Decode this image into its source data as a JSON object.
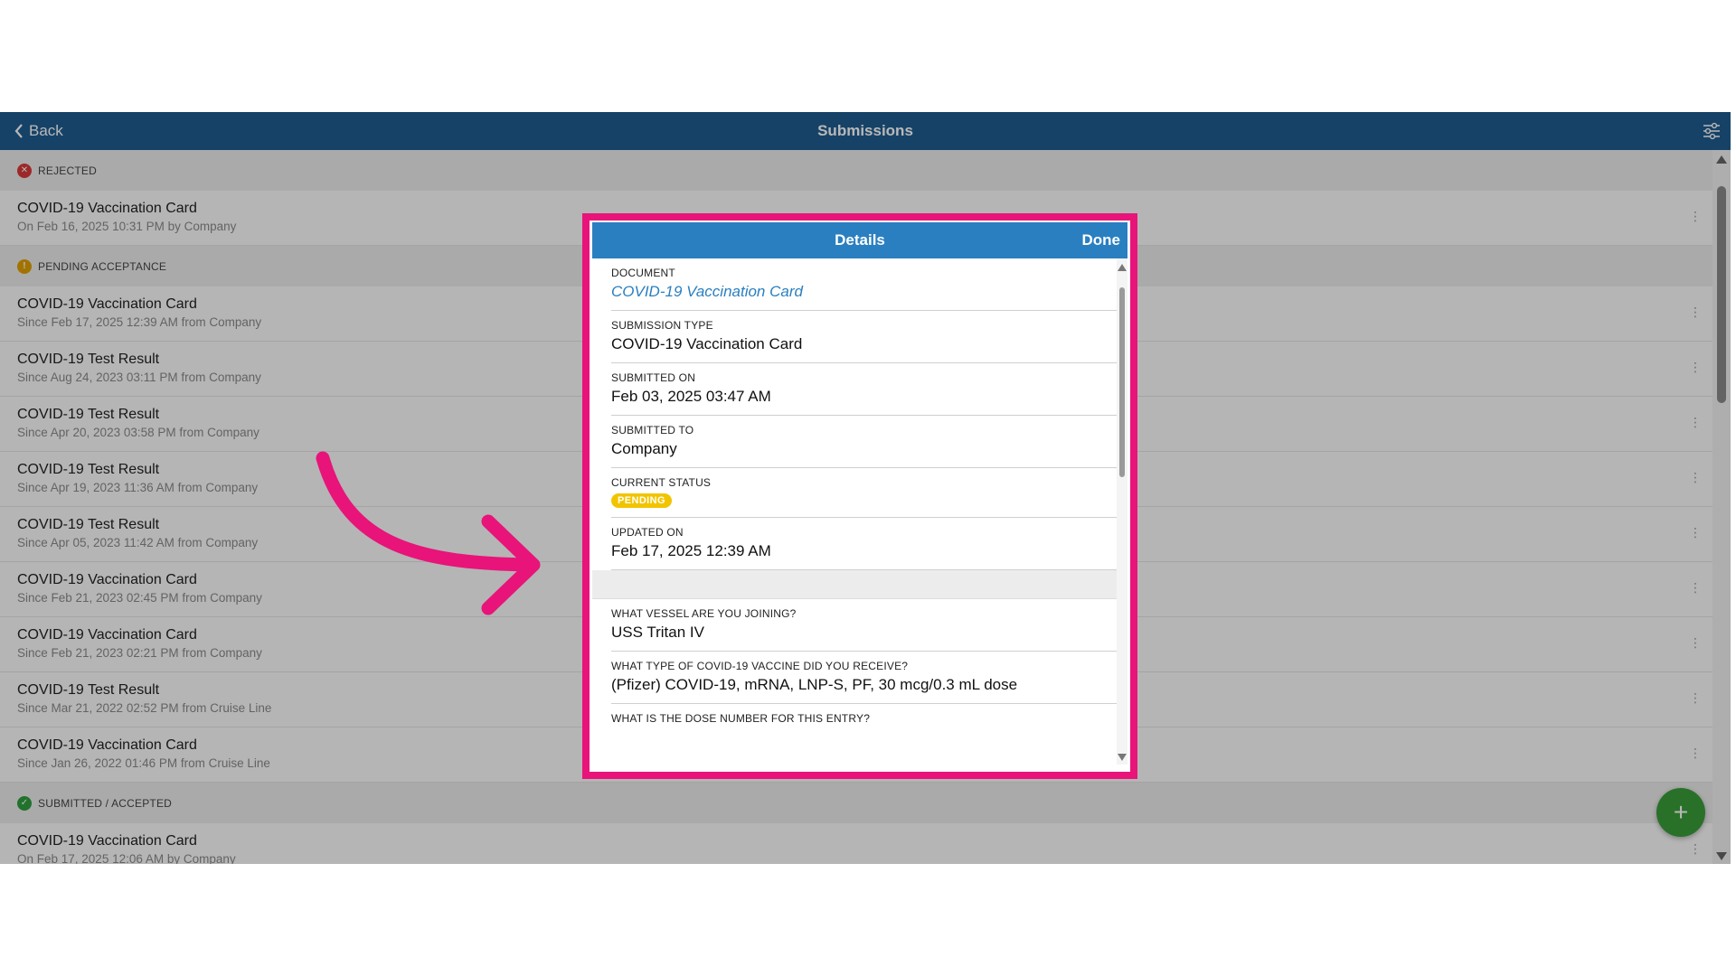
{
  "topbar": {
    "back_label": "Back",
    "title": "Submissions"
  },
  "sections": {
    "rejected": {
      "label": "REJECTED",
      "color": "#d93a3a",
      "items": [
        {
          "title": "COVID-19 Vaccination Card",
          "subtitle": "On Feb 16, 2025 10:31 PM by Company"
        }
      ]
    },
    "pending": {
      "label": "PENDING ACCEPTANCE",
      "color": "#e0a000",
      "items": [
        {
          "title": "COVID-19 Vaccination Card",
          "subtitle": "Since Feb 17, 2025 12:39 AM from Company"
        },
        {
          "title": "COVID-19 Test Result",
          "subtitle": "Since Aug 24, 2023 03:11 PM from Company"
        },
        {
          "title": "COVID-19 Test Result",
          "subtitle": "Since Apr 20, 2023 03:58 PM from Company"
        },
        {
          "title": "COVID-19 Test Result",
          "subtitle": "Since Apr 19, 2023 11:36 AM from Company"
        },
        {
          "title": "COVID-19 Test Result",
          "subtitle": "Since Apr 05, 2023 11:42 AM from Company"
        },
        {
          "title": "COVID-19 Vaccination Card",
          "subtitle": "Since Feb 21, 2023 02:45 PM from Company"
        },
        {
          "title": "COVID-19 Vaccination Card",
          "subtitle": "Since Feb 21, 2023 02:21 PM from Company"
        },
        {
          "title": "COVID-19 Test Result",
          "subtitle": "Since Mar 21, 2022 02:52 PM from Cruise Line"
        },
        {
          "title": "COVID-19 Vaccination Card",
          "subtitle": "Since Jan 26, 2022 01:46 PM from Cruise Line"
        }
      ]
    },
    "accepted": {
      "label": "SUBMITTED / ACCEPTED",
      "color": "#2e9e3e",
      "items": [
        {
          "title": "COVID-19 Vaccination Card",
          "subtitle": "On Feb 17, 2025 12:06 AM by Company"
        }
      ]
    }
  },
  "fab_label": "+",
  "modal": {
    "title": "Details",
    "done_label": "Done",
    "document": {
      "label": "DOCUMENT",
      "value": "COVID-19 Vaccination Card"
    },
    "submission_type": {
      "label": "SUBMISSION TYPE",
      "value": "COVID-19 Vaccination Card"
    },
    "submitted_on": {
      "label": "SUBMITTED ON",
      "value": "Feb 03, 2025 03:47 AM"
    },
    "submitted_to": {
      "label": "SUBMITTED TO",
      "value": "Company"
    },
    "current_status": {
      "label": "CURRENT STATUS",
      "value": "PENDING",
      "color": "#f2c400"
    },
    "updated_on": {
      "label": "UPDATED ON",
      "value": "Feb 17, 2025 12:39 AM"
    },
    "vessel": {
      "label": "WHAT VESSEL ARE YOU JOINING?",
      "value": "USS Tritan IV"
    },
    "vaccine_type": {
      "label": "WHAT TYPE OF COVID-19 VACCINE DID YOU RECEIVE?",
      "value": "(Pfizer) COVID-19, mRNA, LNP-S, PF, 30 mcg/0.3 mL dose"
    },
    "dose_number": {
      "label": "WHAT IS THE DOSE NUMBER FOR THIS ENTRY?"
    }
  },
  "colors": {
    "topbar": "#1f5c8f",
    "modal_header": "#2a7fc0",
    "highlight": "#e8147a",
    "fab": "#3a9d3a"
  }
}
